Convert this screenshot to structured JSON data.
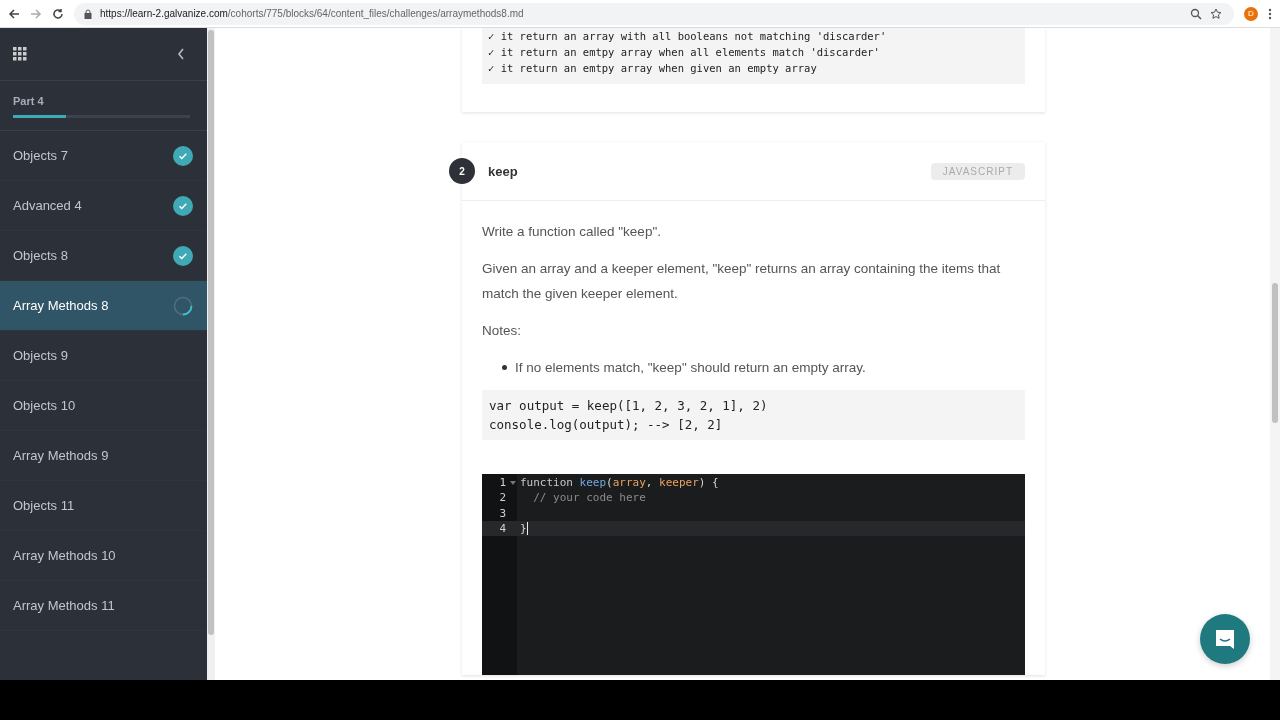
{
  "browser": {
    "url_host": "https://learn-2.galvanize.com",
    "url_path": "/cohorts/775/blocks/64/content_files/challenges/arraymethods8.md",
    "profile_initial": "D"
  },
  "sidebar": {
    "section": "Part 4",
    "level": 0.3,
    "items": [
      {
        "label": "Objects 7",
        "completed": true,
        "in_progress": false,
        "selected": false
      },
      {
        "label": "Advanced 4",
        "completed": true,
        "in_progress": false,
        "selected": false
      },
      {
        "label": "Objects 8",
        "completed": true,
        "in_progress": false,
        "selected": false
      },
      {
        "label": "Array Methods 8",
        "completed": false,
        "in_progress": true,
        "selected": true
      },
      {
        "label": "Objects 9",
        "completed": false,
        "in_progress": false,
        "selected": false
      },
      {
        "label": "Objects 10",
        "completed": false,
        "in_progress": false,
        "selected": false
      },
      {
        "label": "Array Methods 9",
        "completed": false,
        "in_progress": false,
        "selected": false
      },
      {
        "label": "Objects 11",
        "completed": false,
        "in_progress": false,
        "selected": false
      },
      {
        "label": "Array Methods 10",
        "completed": false,
        "in_progress": false,
        "selected": false
      },
      {
        "label": "Array Methods 11",
        "completed": false,
        "in_progress": false,
        "selected": false
      }
    ]
  },
  "previous_tests": [
    "✓ it return an array with all booleans not matching 'discarder'",
    "✓ it return an emtpy array when all elements match 'discarder'",
    "✓ it return an emtpy array when given an empty array"
  ],
  "challenge": {
    "number": "2",
    "title": "keep",
    "language": "JAVASCRIPT",
    "paragraphs": [
      "Write a function called \"keep\".",
      "Given an array and a keeper element, \"keep\" returns an array containing the items that match the given keeper element.",
      "Notes:"
    ],
    "bullets": [
      "If no elements match, \"keep\" should return an empty array."
    ],
    "example": [
      "var output = keep([1, 2, 3, 2, 1], 2)",
      "console.log(output); --> [2, 2]"
    ]
  },
  "editor": {
    "lines": [
      {
        "number": "1",
        "foldable": true,
        "active": false,
        "tokens": [
          {
            "kind": "keyword",
            "text": "function "
          },
          {
            "kind": "name",
            "text": "keep"
          },
          {
            "kind": "plain",
            "text": "("
          },
          {
            "kind": "param",
            "text": "array"
          },
          {
            "kind": "plain",
            "text": ", "
          },
          {
            "kind": "param",
            "text": "keeper"
          },
          {
            "kind": "plain",
            "text": ") {"
          }
        ]
      },
      {
        "number": "2",
        "foldable": false,
        "active": false,
        "tokens": [
          {
            "kind": "comment",
            "text": "  // your code here"
          }
        ]
      },
      {
        "number": "3",
        "foldable": false,
        "active": false
      },
      {
        "number": "4",
        "foldable": false,
        "active": true,
        "tokens": [
          {
            "kind": "plain",
            "text": "}"
          }
        ]
      }
    ]
  }
}
